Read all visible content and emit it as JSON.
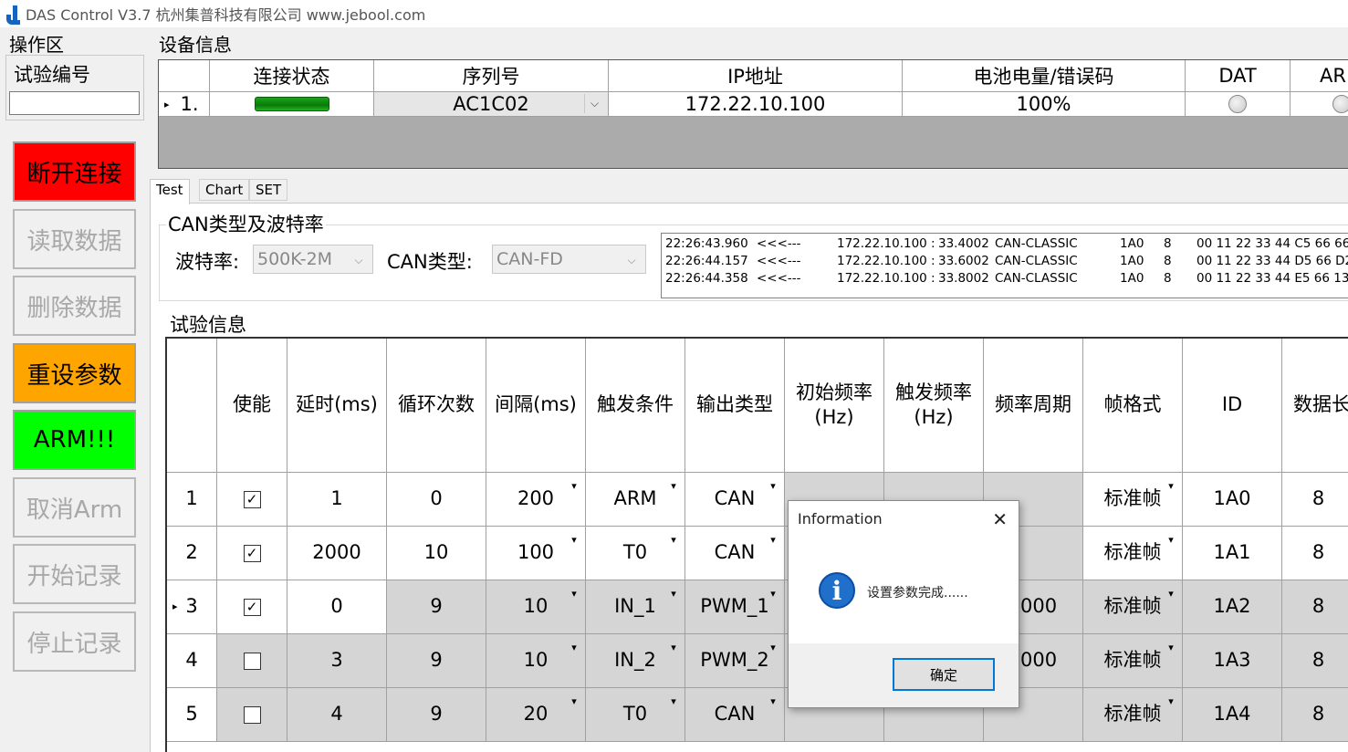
{
  "window": {
    "title": "DAS Control V3.7  杭州集普科技有限公司  www.jebool.com"
  },
  "left": {
    "section_title": "操作区",
    "exp_id_label": "试验编号",
    "exp_id_value": "",
    "buttons": [
      "断开连接",
      "读取数据",
      "删除数据",
      "重设参数",
      "ARM!!!",
      "取消Arm",
      "开始记录",
      "停止记录"
    ]
  },
  "device": {
    "section_title": "设备信息",
    "headers": [
      "连接状态",
      "序列号",
      "IP地址",
      "电池电量/错误码",
      "DAT",
      "AR"
    ],
    "row": {
      "index": "1.",
      "serial": "AC1C02",
      "ip": "172.22.10.100",
      "battery": "100%"
    }
  },
  "tabs": [
    "Test",
    "Chart",
    "SET"
  ],
  "can": {
    "group_title": "CAN类型及波特率",
    "baud_label": "波特率:",
    "baud_value": "500K-2M",
    "type_label": "CAN类型:",
    "type_value": "CAN-FD"
  },
  "log": [
    [
      "22:26:43.960",
      "<<<---",
      "172.22.10.100 :",
      "33.4002",
      "CAN-CLASSIC",
      "1A0",
      "8",
      "00 11 22 33 44 C5 66 66"
    ],
    [
      "22:26:44.157",
      "<<<---",
      "172.22.10.100 :",
      "33.6002",
      "CAN-CLASSIC",
      "1A0",
      "8",
      "00 11 22 33 44 D5 66 D2"
    ],
    [
      "22:26:44.358",
      "<<<---",
      "172.22.10.100 :",
      "33.8002",
      "CAN-CLASSIC",
      "1A0",
      "8",
      "00 11 22 33 44 E5 66 13"
    ]
  ],
  "experiment": {
    "group_title": "试验信息",
    "headers": [
      "",
      "使能",
      "延时(ms)",
      "循环次数",
      "间隔(ms)",
      "触发条件",
      "输出类型",
      "初始频率\n(Hz)",
      "触发频率\n(Hz)",
      "频率周期",
      "帧格式",
      "ID",
      "数据长"
    ],
    "rows": [
      {
        "n": "1",
        "en": true,
        "delay": "1",
        "loops": "0",
        "interval": "200",
        "trigger": "ARM",
        "output": "CAN",
        "f0": "",
        "f1": "",
        "period": "",
        "frame": "标准帧",
        "id": "1A0",
        "len": "8"
      },
      {
        "n": "2",
        "en": true,
        "delay": "2000",
        "loops": "10",
        "interval": "100",
        "trigger": "T0",
        "output": "CAN",
        "f0": "",
        "f1": "",
        "period": "",
        "frame": "标准帧",
        "id": "1A1",
        "len": "8"
      },
      {
        "n": "3",
        "en": true,
        "delay": "0",
        "loops": "9",
        "interval": "10",
        "trigger": "IN_1",
        "output": "PWM_1",
        "f0": "",
        "f1": "",
        "period": "000",
        "frame": "标准帧",
        "id": "1A2",
        "len": "8"
      },
      {
        "n": "4",
        "en": false,
        "delay": "3",
        "loops": "9",
        "interval": "10",
        "trigger": "IN_2",
        "output": "PWM_2",
        "f0": "",
        "f1": "",
        "period": "000",
        "frame": "标准帧",
        "id": "1A3",
        "len": "8"
      },
      {
        "n": "5",
        "en": false,
        "delay": "4",
        "loops": "9",
        "interval": "20",
        "trigger": "T0",
        "output": "CAN",
        "f0": "",
        "f1": "",
        "period": "",
        "frame": "标准帧",
        "id": "1A4",
        "len": "8"
      }
    ]
  },
  "dialog": {
    "title": "Information",
    "message": "设置参数完成......",
    "ok": "确定"
  },
  "colors": {
    "disconnect": "#ff0000",
    "reset": "#ffa500",
    "arm": "#00ff00",
    "connected": "#0a7a0a",
    "info_icon": "#1f6fcb"
  }
}
